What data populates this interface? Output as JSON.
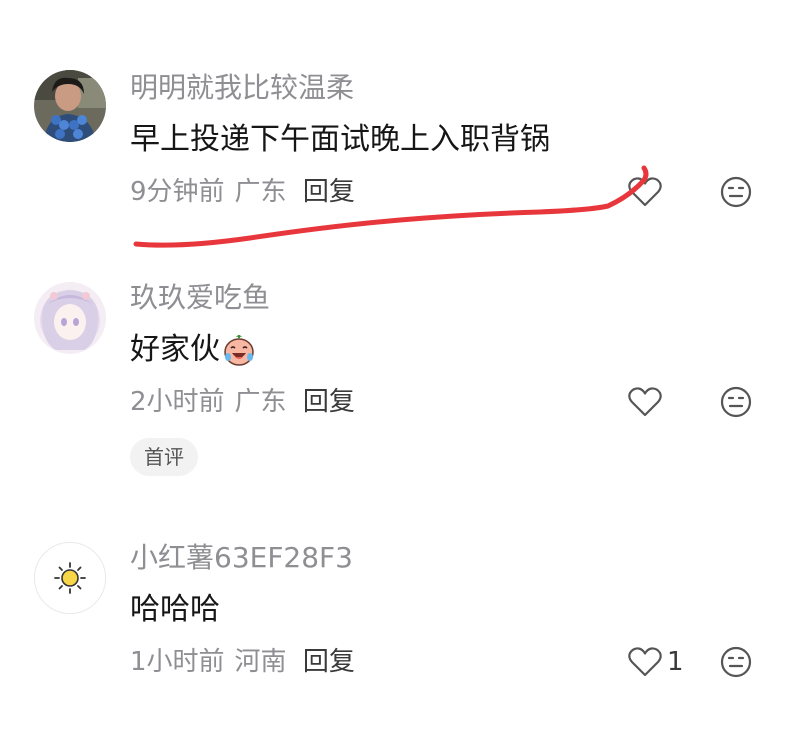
{
  "comments": [
    {
      "username": "明明就我比较温柔",
      "content": "早上投递下午面试晚上入职背锅",
      "time": "9分钟前",
      "location": "广东",
      "reply_label": "回复",
      "like_count": "",
      "avatar": "photo-avatar"
    },
    {
      "username": "玖玖爱吃鱼",
      "content": "好家伙",
      "time": "2小时前",
      "location": "广东",
      "reply_label": "回复",
      "like_count": "",
      "badge": "首评",
      "avatar": "anime-girl-avatar"
    },
    {
      "username": "小红薯63EF28F3",
      "content": "哈哈哈",
      "time": "1小时前",
      "location": "河南",
      "reply_label": "回复",
      "like_count": "1",
      "avatar": "sun-avatar"
    }
  ],
  "colors": {
    "username": "#8e8e93",
    "content": "#161616",
    "annotation": "#e8373c"
  }
}
